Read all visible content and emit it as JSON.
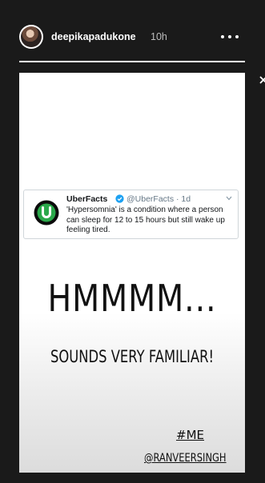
{
  "header": {
    "username": "deepikapadukone",
    "time": "10h",
    "progress": 1.0
  },
  "tweet": {
    "name": "UberFacts",
    "handle_time": "@UberFacts · 1d",
    "text": "'Hypersomnia' is a condition where a person can sleep for 12 to 15 hours but still wake up feeling tired.",
    "logo_letter": "U",
    "accent": "#2aa84a",
    "verified_color": "#1da1f2"
  },
  "story": {
    "headline": "HMMMM...",
    "subline": "SOUNDS VERY FAMILIAR!",
    "hashtag": "#ME",
    "mention": "@RANVEERSINGH"
  },
  "icons": {
    "more": "more-dots-icon",
    "close": "close-icon",
    "verified": "verified-badge-icon",
    "chevron": "chevron-down-icon"
  }
}
